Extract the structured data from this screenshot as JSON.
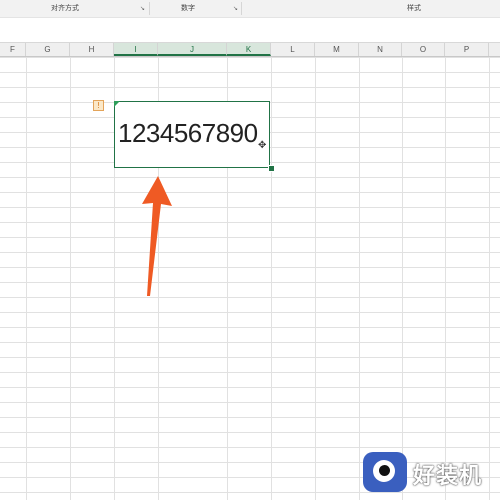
{
  "ribbon": {
    "groups": [
      {
        "label": "对齐方式"
      },
      {
        "label": "数字"
      },
      {
        "label": "样式"
      }
    ],
    "launcher_glyph": "↘"
  },
  "column_headers": [
    "F",
    "G",
    "H",
    "I",
    "J",
    "K",
    "L",
    "M",
    "N",
    "O",
    "P"
  ],
  "active_columns": [
    "I",
    "J",
    "K"
  ],
  "selected_cell": {
    "value": "1234567890",
    "warning_icon": "warning-triangle-icon",
    "cursor_icon": "move-cursor-icon"
  },
  "annotation": {
    "arrow_color": "#ef5a24",
    "arrow_icon": "up-arrow-icon"
  },
  "watermark": {
    "text": "好装机",
    "badge_color": "#3a5fbf"
  },
  "colors": {
    "accent": "#217346"
  }
}
